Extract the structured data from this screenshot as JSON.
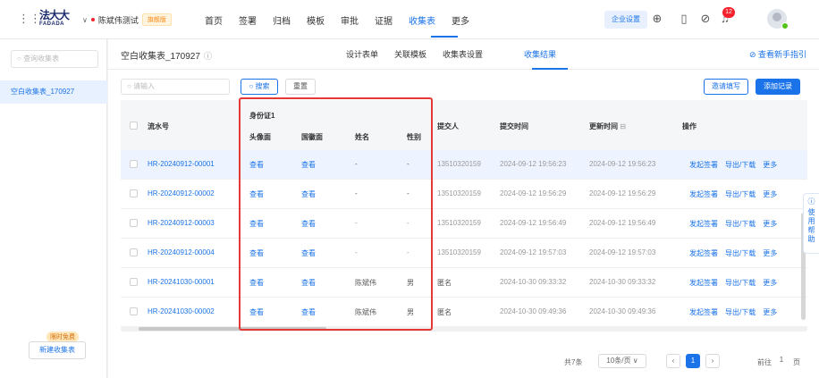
{
  "topbar": {
    "logo_cn": "法大大",
    "logo_en": "FADADA",
    "org_name": "陈斌伟测试",
    "org_badge": "旗舰版",
    "nav": [
      "首页",
      "签署",
      "归档",
      "模板",
      "审批",
      "证据",
      "收集表",
      "更多"
    ],
    "active_nav": "收集表",
    "company_settings": "企业设置",
    "notification_count": "12"
  },
  "sidebar": {
    "search_placeholder": "查询收集表",
    "items": [
      {
        "label": "空白收集表_170927"
      }
    ],
    "promo_tag": "限时免费",
    "new_button": "新建收集表"
  },
  "main": {
    "form_title": "空白收集表_170927",
    "tabs": [
      "设计表单",
      "关联模板",
      "收集表设置",
      "收集结果"
    ],
    "active_tab": "收集结果",
    "guide_link": "查看新手指引",
    "search_placeholder": "请输入",
    "search_button": "搜索",
    "reset_button": "重置",
    "invite_button": "邀请填写",
    "add_button": "添加记录",
    "help_float": "使用帮助"
  },
  "table": {
    "headers": {
      "serial": "流水号",
      "id_group": "身份证1",
      "head_side": "头像面",
      "emblem_side": "国徽面",
      "name": "姓名",
      "gender": "性别",
      "submitter": "提交人",
      "submit_time": "提交时间",
      "update_time": "更新时间",
      "actions": "操作"
    },
    "rows": [
      {
        "serial": "HR-20240912-00001",
        "head": "查看",
        "emblem": "查看",
        "name": "-",
        "gender": "-",
        "submitter": "13510320159",
        "submit_time": "2024-09-12 19:56:23",
        "update_time": "2024-09-12 19:56:23",
        "op1": "发起签署",
        "op2": "导出/下载",
        "op3": "更多"
      },
      {
        "serial": "HR-20240912-00002",
        "head": "查看",
        "emblem": "查看",
        "name": "-",
        "gender": "-",
        "submitter": "13510320159",
        "submit_time": "2024-09-12 19:56:29",
        "update_time": "2024-09-12 19:56:29",
        "op1": "发起签署",
        "op2": "导出/下载",
        "op3": "更多"
      },
      {
        "serial": "HR-20240912-00003",
        "head": "查看",
        "emblem": "查看",
        "name": "-",
        "gender": "-",
        "submitter": "13510320159",
        "submit_time": "2024-09-12 19:56:49",
        "update_time": "2024-09-12 19:56:49",
        "op1": "发起签署",
        "op2": "导出/下载",
        "op3": "更多"
      },
      {
        "serial": "HR-20240912-00004",
        "head": "查看",
        "emblem": "查看",
        "name": "-",
        "gender": "-",
        "submitter": "13510320159",
        "submit_time": "2024-09-12 19:57:03",
        "update_time": "2024-09-12 19:57:03",
        "op1": "发起签署",
        "op2": "导出/下载",
        "op3": "更多"
      },
      {
        "serial": "HR-20241030-00001",
        "head": "查看",
        "emblem": "查看",
        "name": "陈斌伟",
        "gender": "男",
        "submitter": "匿名",
        "submit_time": "2024-10-30 09:33:32",
        "update_time": "2024-10-30 09:33:32",
        "op1": "发起签署",
        "op2": "导出/下载",
        "op3": "更多"
      },
      {
        "serial": "HR-20241030-00002",
        "head": "查看",
        "emblem": "查看",
        "name": "陈斌伟",
        "gender": "男",
        "submitter": "匿名",
        "submit_time": "2024-10-30 09:49:36",
        "update_time": "2024-10-30 09:49:36",
        "op1": "发起签署",
        "op2": "导出/下载",
        "op3": "更多"
      }
    ]
  },
  "pagination": {
    "total": "共7条",
    "page_size": "10条/页",
    "current_page": "1",
    "goto_label": "前往",
    "goto_value": "1",
    "page_suffix": "页"
  },
  "colors": {
    "accent": "#1a73e8",
    "highlight_box": "#e53935"
  }
}
